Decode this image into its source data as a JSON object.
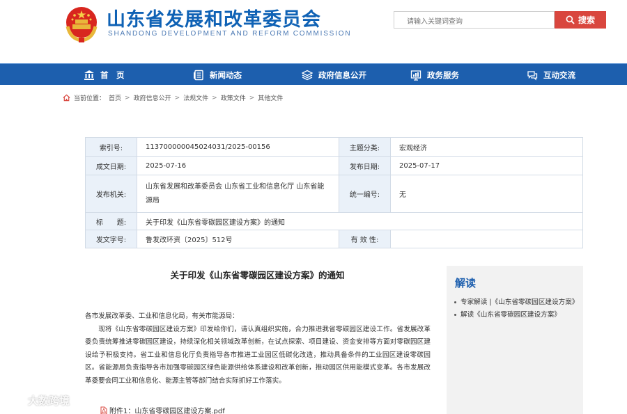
{
  "header": {
    "site_title": "山东省发展和改革委员会",
    "site_subtitle": "SHANDONG DEVELOPMENT AND REFORM COMMISSION",
    "emblem_icon": "national-emblem-icon"
  },
  "search": {
    "placeholder": "请输入关键词查询",
    "button_label": "搜索"
  },
  "nav": {
    "items": [
      {
        "label": "首　页",
        "icon": "bank-building-icon"
      },
      {
        "label": "新闻动态",
        "icon": "news-list-icon"
      },
      {
        "label": "政府信息公开",
        "icon": "layers-icon"
      },
      {
        "label": "政务服务",
        "icon": "chart-board-icon"
      },
      {
        "label": "互动交流",
        "icon": "chat-icon"
      }
    ]
  },
  "breadcrumb": {
    "prefix": "当前位置：",
    "items": [
      "首页",
      "政府信息公开",
      "法规文件",
      "政策文件",
      "其他文件"
    ],
    "separator": ">"
  },
  "info": {
    "index_label": "索引号:",
    "index_value": "113700000045024031/2025-00156",
    "topic_label": "主题分类:",
    "topic_value": "宏观经济",
    "written_label": "成文日期:",
    "written_value": "2025-07-16",
    "publish_label": "发布日期:",
    "publish_value": "2025-07-17",
    "issuer_label": "发布机关:",
    "issuer_value": "山东省发展和改革委员会 山东省工业和信息化厅 山东省能源局",
    "serial_label": "统一编号:",
    "serial_value": "无",
    "title_label": "标　　题:",
    "title_value": "关于印发《山东省零碳园区建设方案》的通知",
    "docno_label": "发文字号:",
    "docno_value": "鲁发改环资〔2025〕512号",
    "validity_label": "有 效 性:",
    "validity_value": ""
  },
  "article": {
    "title": "关于印发《山东省零碳园区建设方案》的通知",
    "salutation": "各市发展改革委、工业和信息化局，有关市能源局：",
    "paragraph": "现将《山东省零碳园区建设方案》印发给你们，请认真组织实施，合力推进我省零碳园区建设工作。省发展改革委负责统筹推进零碳园区建设，持续深化相关领域改革创新，在试点探索、项目建设、资金安排等方面对零碳园区建设给予积极支持。省工业和信息化厅负责指导各市推进工业园区低碳化改造，推动具备条件的工业园区建设零碳园区。省能源局负责指导各市加强零碳园区绿色能源供给体系建设和改革创新，推动园区供用能模式变革。各市发展改革委要会同工业和信息化、能源主管等部门结合实际抓好工作落实。",
    "attachment": "附件1：山东省零碳园区建设方案.pdf"
  },
  "sidebar": {
    "title": "解读",
    "items": [
      "专家解读 |《山东省零碳园区建设方案》",
      "解读《山东省零碳园区建设方案》"
    ]
  },
  "watermark": {
    "text": "大数跨境"
  },
  "colors": {
    "brand_blue": "#1d5fae",
    "search_red": "#d9463e",
    "label_bg": "#eaf1f9"
  }
}
